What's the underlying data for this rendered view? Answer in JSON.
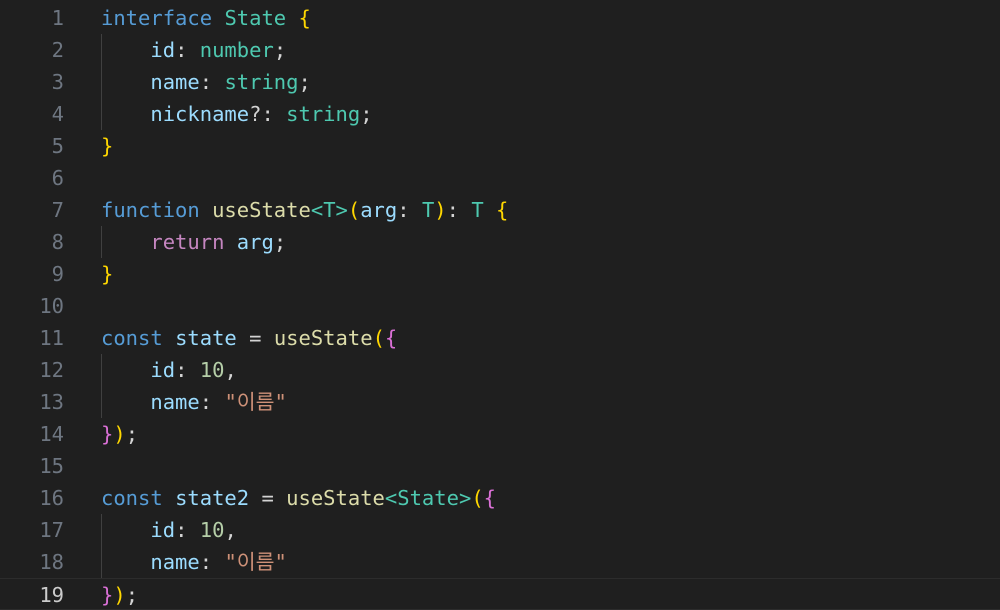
{
  "editor": {
    "language": "typescript",
    "current_line": 19,
    "colors": {
      "background": "#1f1f1f",
      "line_number": "#6e7681",
      "keyword": "#569cd6",
      "control_keyword": "#c586c0",
      "type": "#4ec9b0",
      "variable": "#9cdcfe",
      "function": "#dcdcaa",
      "number": "#b5cea8",
      "string": "#ce9178",
      "bracket_level_1": "#ffd700",
      "bracket_level_2": "#da70d6"
    },
    "lines": [
      {
        "number": "1",
        "tokens": [
          {
            "text": "interface",
            "kind": "kw"
          },
          {
            "text": " ",
            "kind": "pun"
          },
          {
            "text": "State",
            "kind": "type"
          },
          {
            "text": " ",
            "kind": "pun"
          },
          {
            "text": "{",
            "kind": "b1"
          }
        ]
      },
      {
        "number": "2",
        "tokens": [
          {
            "text": "    ",
            "kind": "pun"
          },
          {
            "text": "id",
            "kind": "var"
          },
          {
            "text": ": ",
            "kind": "pun"
          },
          {
            "text": "number",
            "kind": "type"
          },
          {
            "text": ";",
            "kind": "pun"
          }
        ]
      },
      {
        "number": "3",
        "tokens": [
          {
            "text": "    ",
            "kind": "pun"
          },
          {
            "text": "name",
            "kind": "var"
          },
          {
            "text": ": ",
            "kind": "pun"
          },
          {
            "text": "string",
            "kind": "type"
          },
          {
            "text": ";",
            "kind": "pun"
          }
        ]
      },
      {
        "number": "4",
        "tokens": [
          {
            "text": "    ",
            "kind": "pun"
          },
          {
            "text": "nickname",
            "kind": "var"
          },
          {
            "text": "?: ",
            "kind": "pun"
          },
          {
            "text": "string",
            "kind": "type"
          },
          {
            "text": ";",
            "kind": "pun"
          }
        ]
      },
      {
        "number": "5",
        "tokens": [
          {
            "text": "}",
            "kind": "b1"
          }
        ]
      },
      {
        "number": "6",
        "tokens": []
      },
      {
        "number": "7",
        "tokens": [
          {
            "text": "function",
            "kind": "kw"
          },
          {
            "text": " ",
            "kind": "pun"
          },
          {
            "text": "useState",
            "kind": "fn"
          },
          {
            "text": "<",
            "kind": "type"
          },
          {
            "text": "T",
            "kind": "type"
          },
          {
            "text": ">",
            "kind": "type"
          },
          {
            "text": "(",
            "kind": "b1"
          },
          {
            "text": "arg",
            "kind": "var"
          },
          {
            "text": ": ",
            "kind": "pun"
          },
          {
            "text": "T",
            "kind": "type"
          },
          {
            "text": ")",
            "kind": "b1"
          },
          {
            "text": ": ",
            "kind": "pun"
          },
          {
            "text": "T",
            "kind": "type"
          },
          {
            "text": " ",
            "kind": "pun"
          },
          {
            "text": "{",
            "kind": "b1"
          }
        ]
      },
      {
        "number": "8",
        "tokens": [
          {
            "text": "    ",
            "kind": "pun"
          },
          {
            "text": "return",
            "kind": "ctl"
          },
          {
            "text": " ",
            "kind": "pun"
          },
          {
            "text": "arg",
            "kind": "var"
          },
          {
            "text": ";",
            "kind": "pun"
          }
        ]
      },
      {
        "number": "9",
        "tokens": [
          {
            "text": "}",
            "kind": "b1"
          }
        ]
      },
      {
        "number": "10",
        "tokens": []
      },
      {
        "number": "11",
        "tokens": [
          {
            "text": "const",
            "kind": "kw"
          },
          {
            "text": " ",
            "kind": "pun"
          },
          {
            "text": "state",
            "kind": "var"
          },
          {
            "text": " = ",
            "kind": "pun"
          },
          {
            "text": "useState",
            "kind": "fn"
          },
          {
            "text": "(",
            "kind": "b1"
          },
          {
            "text": "{",
            "kind": "b2"
          }
        ]
      },
      {
        "number": "12",
        "tokens": [
          {
            "text": "    ",
            "kind": "pun"
          },
          {
            "text": "id",
            "kind": "var"
          },
          {
            "text": ": ",
            "kind": "pun"
          },
          {
            "text": "10",
            "kind": "num"
          },
          {
            "text": ",",
            "kind": "pun"
          }
        ]
      },
      {
        "number": "13",
        "tokens": [
          {
            "text": "    ",
            "kind": "pun"
          },
          {
            "text": "name",
            "kind": "var"
          },
          {
            "text": ": ",
            "kind": "pun"
          },
          {
            "text": "\"이름\"",
            "kind": "str"
          }
        ]
      },
      {
        "number": "14",
        "tokens": [
          {
            "text": "}",
            "kind": "b2"
          },
          {
            "text": ")",
            "kind": "b1"
          },
          {
            "text": ";",
            "kind": "pun"
          }
        ]
      },
      {
        "number": "15",
        "tokens": []
      },
      {
        "number": "16",
        "tokens": [
          {
            "text": "const",
            "kind": "kw"
          },
          {
            "text": " ",
            "kind": "pun"
          },
          {
            "text": "state2",
            "kind": "var"
          },
          {
            "text": " = ",
            "kind": "pun"
          },
          {
            "text": "useState",
            "kind": "fn"
          },
          {
            "text": "<",
            "kind": "type"
          },
          {
            "text": "State",
            "kind": "type"
          },
          {
            "text": ">",
            "kind": "type"
          },
          {
            "text": "(",
            "kind": "b1"
          },
          {
            "text": "{",
            "kind": "b2"
          }
        ]
      },
      {
        "number": "17",
        "tokens": [
          {
            "text": "    ",
            "kind": "pun"
          },
          {
            "text": "id",
            "kind": "var"
          },
          {
            "text": ": ",
            "kind": "pun"
          },
          {
            "text": "10",
            "kind": "num"
          },
          {
            "text": ",",
            "kind": "pun"
          }
        ]
      },
      {
        "number": "18",
        "tokens": [
          {
            "text": "    ",
            "kind": "pun"
          },
          {
            "text": "name",
            "kind": "var"
          },
          {
            "text": ": ",
            "kind": "pun"
          },
          {
            "text": "\"이름\"",
            "kind": "str"
          }
        ]
      },
      {
        "number": "19",
        "tokens": [
          {
            "text": "}",
            "kind": "b2"
          },
          {
            "text": ")",
            "kind": "b1"
          },
          {
            "text": ";",
            "kind": "pun"
          }
        ]
      }
    ]
  }
}
